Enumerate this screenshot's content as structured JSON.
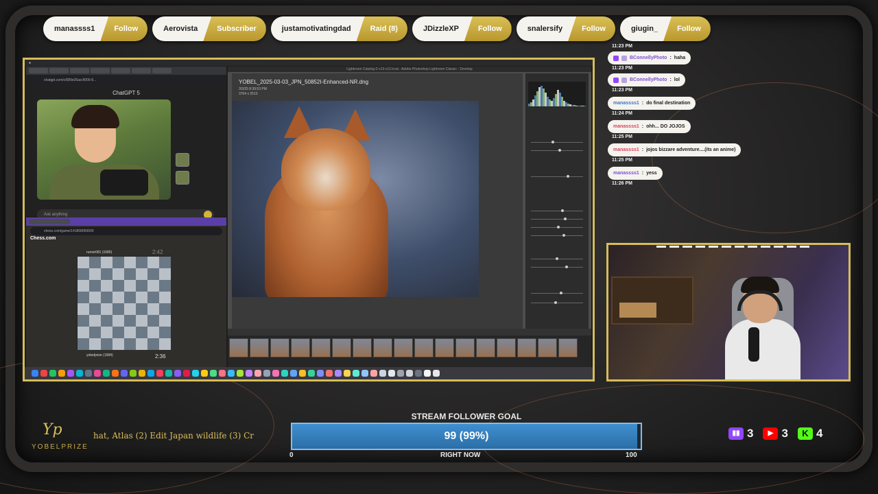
{
  "alerts": [
    {
      "name": "manassss1",
      "action": "Follow"
    },
    {
      "name": "Aerovista",
      "action": "Subscriber"
    },
    {
      "name": "justamotivatingdad",
      "action": "Raid (8)"
    },
    {
      "name": "JDizzleXP",
      "action": "Follow"
    },
    {
      "name": "snalersify",
      "action": "Follow"
    },
    {
      "name": "giugin_",
      "action": "Follow"
    }
  ],
  "screen": {
    "chatgpt": {
      "title": "ChatGPT 5",
      "placeholder": "Ask anything",
      "url": "chatgpt.com/c/689e26aa-8000-8..."
    },
    "chess": {
      "brand": "Chess.com",
      "url": "chess.com/game/141868069600",
      "opponent": "rumor081 (1680)",
      "opponent_clock": "2:42",
      "player": "yobelprize (1584)",
      "player_clock": "2:36"
    },
    "lightroom": {
      "filename": "YOBEL_2025-03-03_JPN_50852I-Enhanced-NR.dng",
      "meta_line1": "3/3/25 8:39:53 PM",
      "meta_line2": "3764 x 2510",
      "window_title": "Lightroom Catalog-2-v13-v12.lrcat - Adobe Photoshop Lightroom Classic - Develop"
    }
  },
  "chat": [
    {
      "time": "11:23 PM",
      "user": "",
      "text": ""
    },
    {
      "user": "BConnellyPhoto",
      "text": "haha",
      "color": "purple",
      "time": "11:23 PM"
    },
    {
      "user": "BConnellyPhoto",
      "text": "lol",
      "color": "purple",
      "time": "11:23 PM"
    },
    {
      "user": "manassss1",
      "text": "do final destination",
      "color": "blue",
      "time": "11:24 PM"
    },
    {
      "user": "manassss1",
      "text": "ohh... DO JOJOS",
      "color": "magenta",
      "time": "11:25 PM"
    },
    {
      "user": "manassss1",
      "text": "jojos bizzare adventure....(its an anime)",
      "color": "magenta",
      "time": "11:25 PM"
    },
    {
      "user": "manassss1",
      "text": "yess",
      "color": "purple",
      "time": "11:26 PM"
    }
  ],
  "brand": {
    "name": "YOBELPRIZE",
    "mark": "Yp"
  },
  "ticker": "hat, Atlas (2) Edit Japan wildlife (3) Cr",
  "goal": {
    "title": "STREAM FOLLOWER GOAL",
    "display": "99 (99%)",
    "current": 99,
    "target": 100,
    "percent": 99,
    "min_label": "0",
    "max_label": "100",
    "subtitle": "RIGHT NOW"
  },
  "platform_counts": [
    {
      "platform": "twitch",
      "icon": "twitch-icon",
      "count": "3",
      "color": "#9146ff"
    },
    {
      "platform": "youtube",
      "icon": "youtube-icon",
      "count": "3",
      "color": "#ff0000"
    },
    {
      "platform": "kick",
      "icon": "kick-icon",
      "count": "4",
      "color": "#53fc18"
    }
  ]
}
